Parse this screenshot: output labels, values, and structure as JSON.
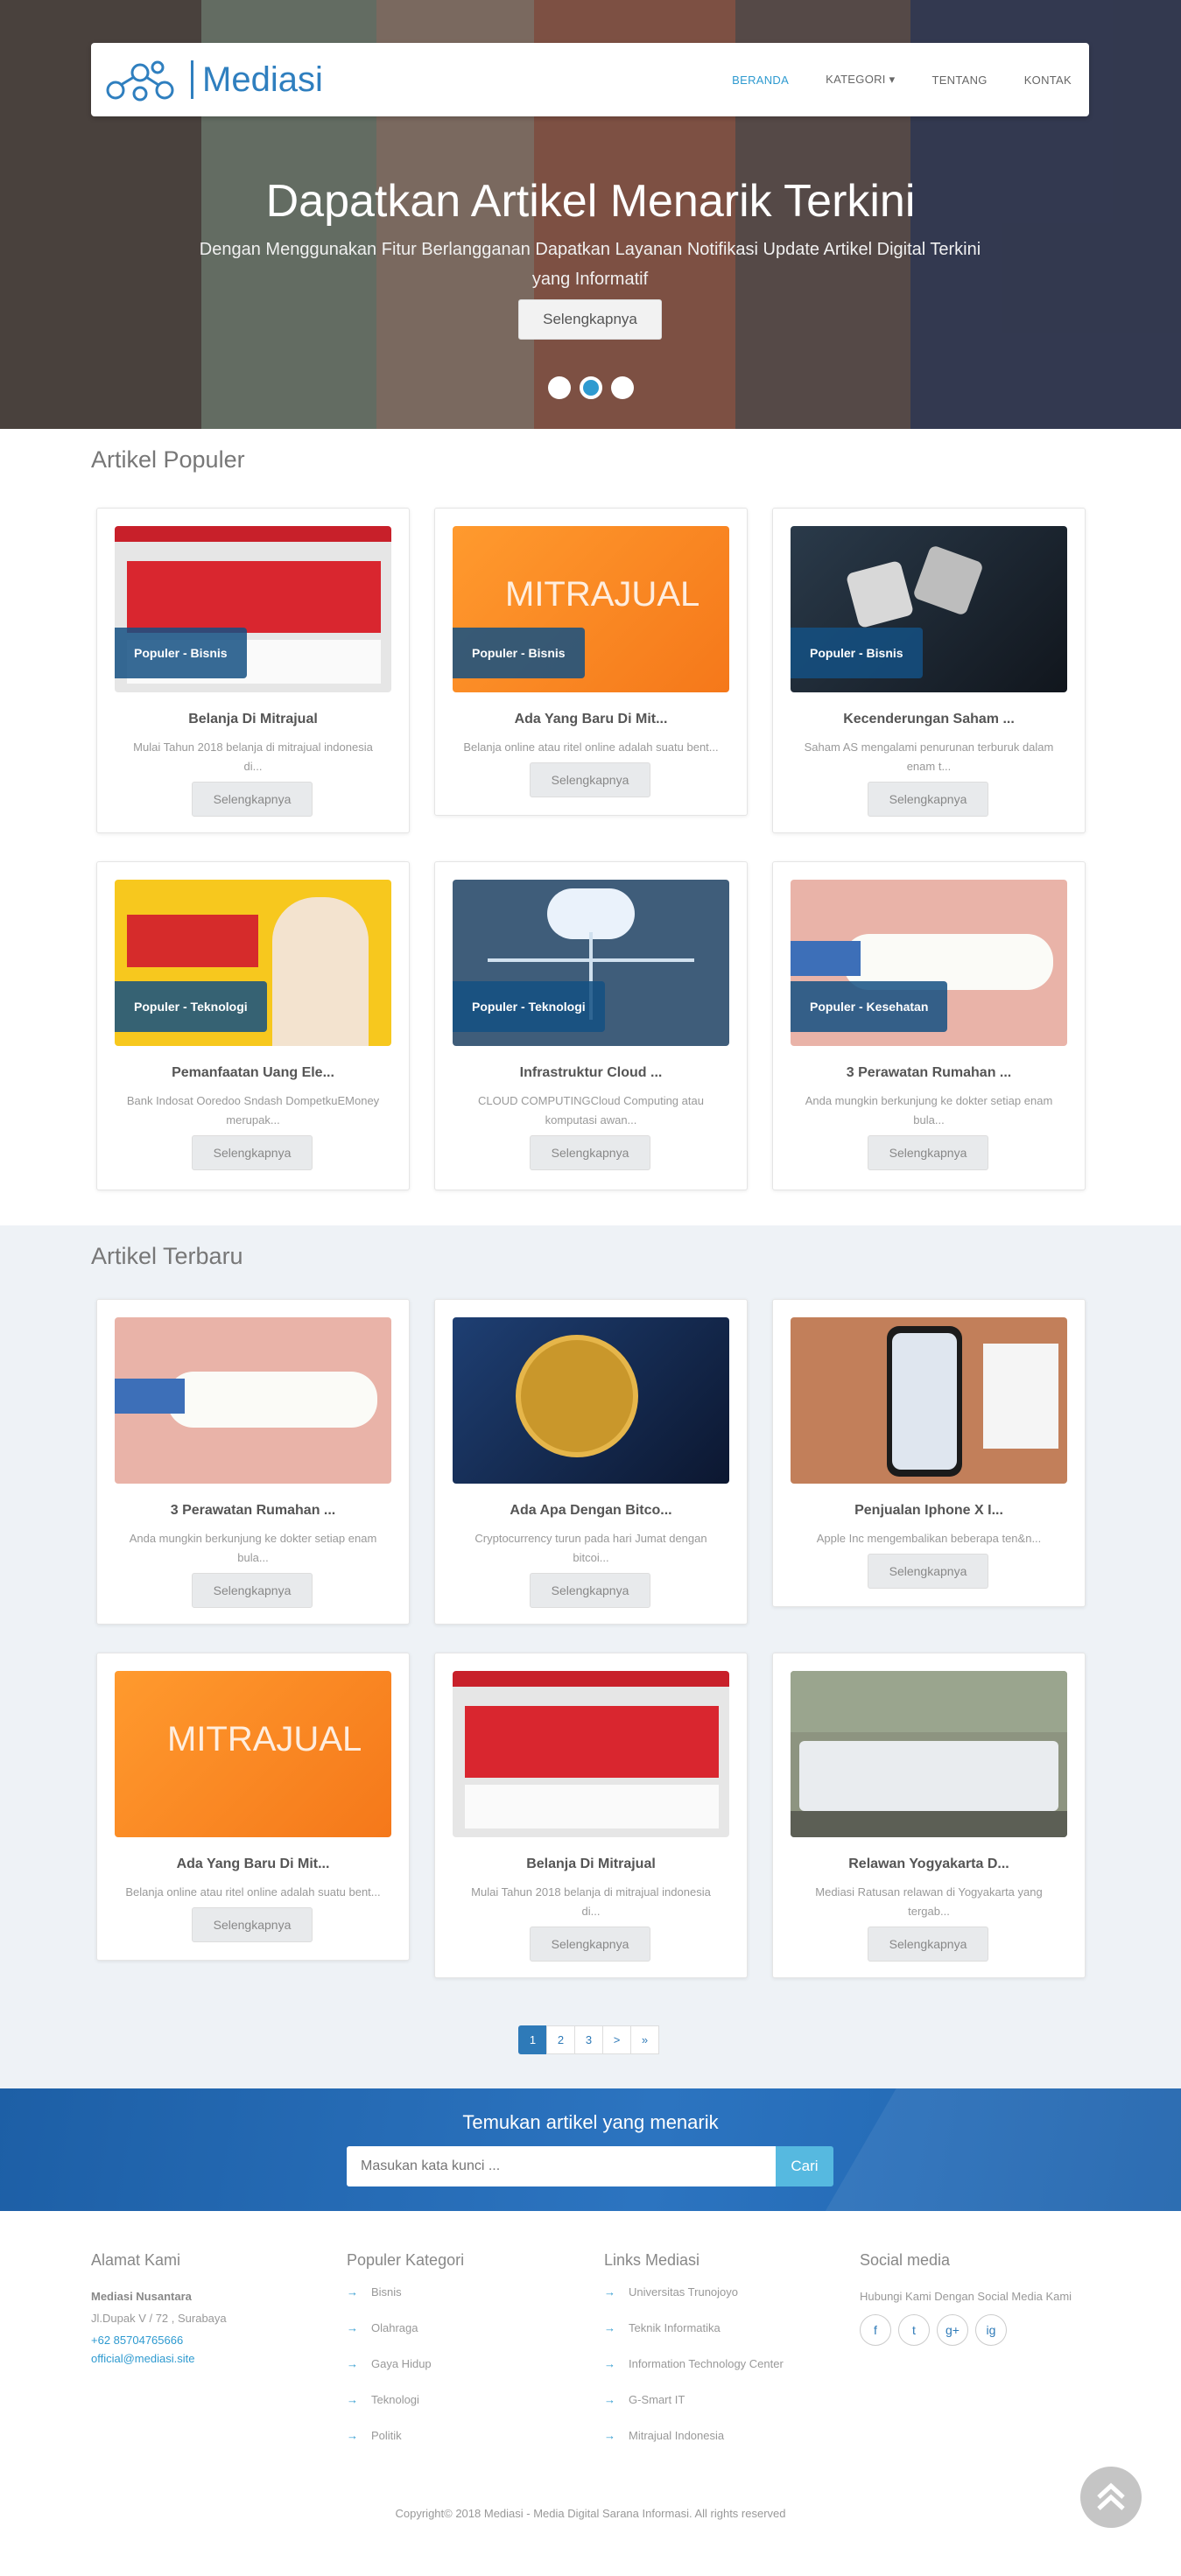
{
  "nav": {
    "brand": "Mediasi",
    "items": [
      {
        "label": "BERANDA",
        "active": true
      },
      {
        "label": "KATEGORI ▾",
        "active": false
      },
      {
        "label": "TENTANG",
        "active": false
      },
      {
        "label": "KONTAK",
        "active": false
      }
    ]
  },
  "hero": {
    "title": "Dapatkan Artikel Menarik Terkini",
    "subtitle": "Dengan Menggunakan Fitur Berlangganan Dapatkan Layanan Notifikasi Update Artikel Digital Terkini yang Informatif",
    "button": "Selengkapnya",
    "slides": 3,
    "active_slide": 2
  },
  "populer": {
    "title": "Artikel Populer",
    "cards": [
      {
        "tag": "Populer - Bisnis",
        "title": "Belanja Di Mitrajual",
        "desc": "Mulai Tahun 2018 belanja di mitrajual indonesia di...",
        "button": "Selengkapnya",
        "image": "mitrajual-banner"
      },
      {
        "tag": "Populer - Bisnis",
        "title": "Ada Yang Baru Di Mit...",
        "desc": "Belanja online atau ritel online adalah suatu bent...",
        "button": "Selengkapnya",
        "image": "mitrajual-orange"
      },
      {
        "tag": "Populer - Bisnis",
        "title": "Kecenderungan Saham ...",
        "desc": "Saham AS mengalami penurunan terburuk dalam enam t...",
        "button": "Selengkapnya",
        "image": "buy-sell-dice"
      },
      {
        "tag": "Populer - Teknologi",
        "title": "Pemanfaatan Uang Ele...",
        "desc": "Bank Indosat Ooredoo Sndash DompetkuEMoney merupak...",
        "button": "Selengkapnya",
        "image": "indosat-promo"
      },
      {
        "tag": "Populer - Teknologi",
        "title": "Infrastruktur Cloud ...",
        "desc": "CLOUD COMPUTINGCloud Computing atau komputasi awan...",
        "button": "Selengkapnya",
        "image": "cloud-network"
      },
      {
        "tag": "Populer - Kesehatan",
        "title": "3 Perawatan Rumahan ...",
        "desc": "Anda mungkin berkunjung ke dokter setiap enam bula...",
        "button": "Selengkapnya",
        "image": "teeth-brushing"
      }
    ]
  },
  "terbaru": {
    "title": "Artikel Terbaru",
    "cards": [
      {
        "title": "3 Perawatan Rumahan ...",
        "desc": "Anda mungkin berkunjung ke dokter setiap enam bula...",
        "button": "Selengkapnya",
        "image": "teeth-brushing"
      },
      {
        "title": "Ada Apa Dengan Bitco...",
        "desc": "Cryptocurrency turun pada hari Jumat dengan bitcoi...",
        "button": "Selengkapnya",
        "image": "bitcoin"
      },
      {
        "title": "Penjualan Iphone X I...",
        "desc": "Apple Inc mengembalikan beberapa ten&n...",
        "button": "Selengkapnya",
        "image": "iphone-x"
      },
      {
        "title": "Ada Yang Baru Di Mit...",
        "desc": "Belanja online atau ritel online adalah suatu bent...",
        "button": "Selengkapnya",
        "image": "mitrajual-orange"
      },
      {
        "title": "Belanja Di Mitrajual",
        "desc": "Mulai Tahun 2018 belanja di mitrajual indonesia di...",
        "button": "Selengkapnya",
        "image": "mitrajual-banner"
      },
      {
        "title": "Relawan Yogyakarta D...",
        "desc": "Mediasi Ratusan relawan di Yogyakarta yang tergab...",
        "button": "Selengkapnya",
        "image": "volunteers-group"
      }
    ]
  },
  "pagination": {
    "pages": [
      "1",
      "2",
      "3",
      ">",
      "»"
    ],
    "active": "1"
  },
  "search": {
    "title": "Temukan artikel yang menarik",
    "placeholder": "Masukan kata kunci ...",
    "button": "Cari"
  },
  "footer": {
    "address": {
      "heading": "Alamat Kami",
      "company": "Mediasi Nusantara",
      "street": "Jl.Dupak V / 72 , Surabaya",
      "phone": "+62 85704765666",
      "email": "official@mediasi.site"
    },
    "categories": {
      "heading": "Populer Kategori",
      "items": [
        "Bisnis",
        "Olahraga",
        "Gaya Hidup",
        "Teknologi",
        "Politik"
      ]
    },
    "links": {
      "heading": "Links Mediasi",
      "items": [
        "Universitas Trunojoyo",
        "Teknik Informatika",
        "Information Technology Center",
        "G-Smart IT",
        "Mitrajual Indonesia"
      ]
    },
    "social": {
      "heading": "Social media",
      "text": "Hubungi Kami Dengan Social Media Kami",
      "icons": [
        "f",
        "t",
        "g+",
        "ig"
      ]
    },
    "copyright": "Copyright© 2018 Mediasi - Media Digital Sarana Informasi. All rights reserved"
  },
  "colors": {
    "primary": "#2e7ab8",
    "accent": "#2e9ad0",
    "band": "#2c74c0"
  }
}
